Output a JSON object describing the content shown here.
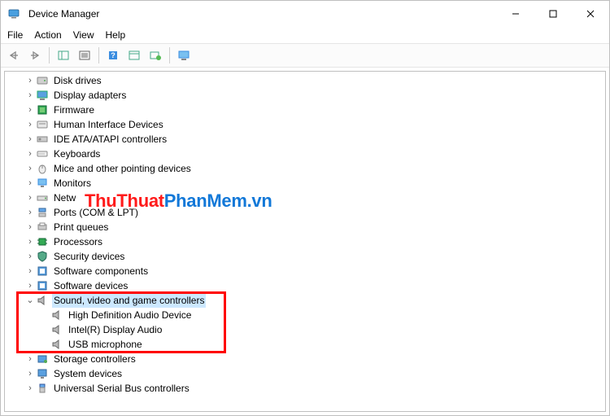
{
  "window": {
    "title": "Device Manager"
  },
  "menu": {
    "file": "File",
    "action": "Action",
    "view": "View",
    "help": "Help"
  },
  "watermark": {
    "part1": "ThuThuat",
    "part2": "PhanMem.vn"
  },
  "tree": {
    "disk_drives": "Disk drives",
    "display_adapters": "Display adapters",
    "firmware": "Firmware",
    "hid": "Human Interface Devices",
    "ide": "IDE ATA/ATAPI controllers",
    "keyboards": "Keyboards",
    "mice": "Mice and other pointing devices",
    "monitors": "Monitors",
    "network": "Netw",
    "ports": "Ports (COM & LPT)",
    "print_queues": "Print queues",
    "processors": "Processors",
    "security": "Security devices",
    "software_components": "Software components",
    "software_devices": "Software devices",
    "sound": "Sound, video and game controllers",
    "sound_children": {
      "hd_audio": "High Definition Audio Device",
      "intel_audio": "Intel(R) Display Audio",
      "usb_mic": "USB microphone"
    },
    "storage": "Storage controllers",
    "system": "System devices",
    "usb": "Universal Serial Bus controllers"
  }
}
